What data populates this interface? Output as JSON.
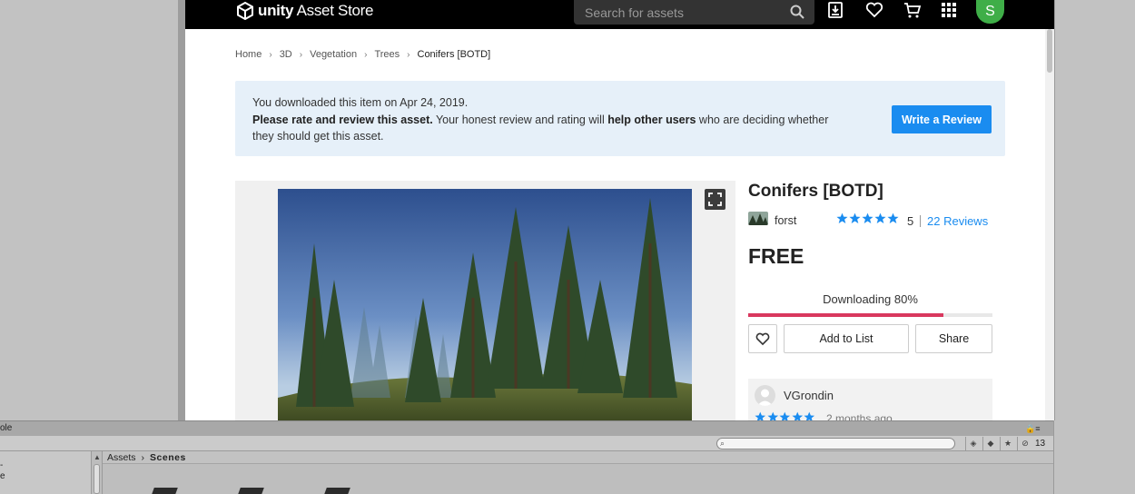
{
  "store": {
    "logo_text_bold": "unity",
    "logo_text": " Asset Store",
    "search_placeholder": "Search for assets",
    "avatar_initial": "S"
  },
  "breadcrumb": [
    "Home",
    "3D",
    "Vegetation",
    "Trees",
    "Conifers [BOTD]"
  ],
  "notice": {
    "line1": "You downloaded this item on Apr 24, 2019.",
    "bold1": "Please rate and review this asset.",
    "mid": " Your honest review and rating will ",
    "bold2": "help other users",
    "end": " who are deciding whether they should get this asset.",
    "button": "Write a Review"
  },
  "asset": {
    "title": "Conifers [BOTD]",
    "publisher": "forst",
    "rating": "5",
    "rating_stars": 5,
    "reviews": "22 Reviews",
    "price": "FREE",
    "download_label": "Downloading 80%",
    "download_progress": 0.8,
    "add_to_list": "Add to List",
    "share": "Share"
  },
  "review": {
    "user": "VGrondin",
    "stars": 5,
    "time": "2 months ago"
  },
  "unity": {
    "panel_tab": "ole",
    "left_label": "e",
    "breadcrumb_root": "Assets",
    "breadcrumb_current": "Scenes",
    "visible_count": "13"
  },
  "colors": {
    "accent_blue": "#1a8cf0",
    "progress": "#d9385e",
    "notice_bg": "#e6f0f9",
    "avatar": "#3fae48"
  }
}
